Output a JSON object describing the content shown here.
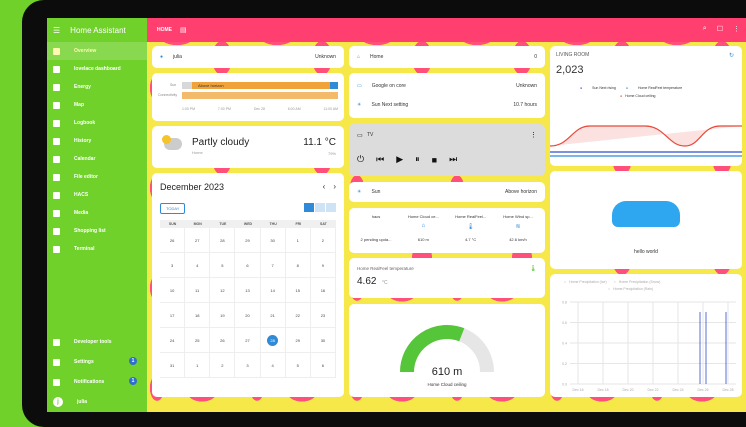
{
  "sidebar": {
    "title": "Home Assistant",
    "items": [
      {
        "label": "Overview",
        "active": true
      },
      {
        "label": "lovelace dashboard"
      },
      {
        "label": "Energy"
      },
      {
        "label": "Map"
      },
      {
        "label": "Logbook"
      },
      {
        "label": "History"
      },
      {
        "label": "Calendar"
      },
      {
        "label": "File editor"
      },
      {
        "label": "HACS"
      },
      {
        "label": "Media"
      },
      {
        "label": "Shopping list"
      },
      {
        "label": "Terminal"
      }
    ],
    "bottom": [
      {
        "label": "Developer tools"
      },
      {
        "label": "Settings",
        "badge": "1"
      },
      {
        "label": "Notifications",
        "badge": "1"
      },
      {
        "label": "julia",
        "avatar": "j"
      }
    ]
  },
  "topbar": {
    "title": "HOME"
  },
  "person": {
    "name": "julia",
    "state": "Unknown"
  },
  "history": {
    "labels": [
      "Sun",
      "Connectivity"
    ],
    "bar_label": "Above horizon",
    "ticks": [
      "1:00 PM",
      "7:00 PM",
      "Dec 28",
      "6:00 AM",
      "11:00 AM"
    ]
  },
  "weather": {
    "condition": "Partly cloudy",
    "sub": "Home",
    "temp": "11.1 °C",
    "hum": "79%"
  },
  "calendar": {
    "title": "December 2023",
    "today_btn": "TODAY",
    "days": [
      "SUN",
      "MON",
      "TUE",
      "WED",
      "THU",
      "FRI",
      "SAT"
    ],
    "cells": [
      "26",
      "27",
      "28",
      "29",
      "30",
      "1",
      "2",
      "3",
      "4",
      "5",
      "6",
      "7",
      "8",
      "9",
      "10",
      "11",
      "12",
      "13",
      "14",
      "15",
      "16",
      "17",
      "18",
      "19",
      "20",
      "21",
      "22",
      "23",
      "24",
      "25",
      "26",
      "27",
      "28",
      "29",
      "30",
      "31",
      "1",
      "2",
      "3",
      "4",
      "5",
      "6"
    ],
    "today_index": 32
  },
  "home_row": {
    "label": "Home",
    "value": "0"
  },
  "entities": [
    {
      "label": "Google on core",
      "value": "Unknown"
    },
    {
      "label": "Sun Next setting",
      "value": "10.7 hours"
    }
  ],
  "media": {
    "title": "TV"
  },
  "sun": {
    "label": "Sun",
    "value": "Above horizon"
  },
  "glance": [
    {
      "title": "hacs",
      "value": "2 pending upda..."
    },
    {
      "title": "Home Cloud ce...",
      "value": "610 m"
    },
    {
      "title": "Home RealFeel...",
      "value": "4.7 °C"
    },
    {
      "title": "Home Wind sp...",
      "value": "42.6 km/h"
    }
  ],
  "sensor": {
    "title": "Home RealFeel temperature",
    "value": "4.62",
    "unit": "°C"
  },
  "gauge": {
    "value": "610 m",
    "label": "Home Cloud ceiling",
    "fraction": 0.62
  },
  "living": {
    "title": "LIVING ROOM",
    "value": "2,023",
    "legend": [
      "Sun Next rising",
      "Home RealFeel temperature",
      "Home Cloud ceiling"
    ]
  },
  "picture": {
    "label": "hello world"
  },
  "precip": {
    "legend": [
      "Home Precipitation (Ice)",
      "Home Precipitation (Snow)",
      "Home Precipitation (Rain)"
    ],
    "yticks": [
      "0.8",
      "0.6",
      "0.4",
      "0.2",
      "0.0"
    ],
    "xticks": [
      "Dec 16",
      "Dec 18",
      "Dec 20",
      "Dec 22",
      "Dec 24",
      "Dec 26",
      "Dec 28"
    ]
  },
  "colors": {
    "sidebar": "#6fd12a",
    "topbar": "#ff3f6f",
    "accent": "#2f8ad8",
    "gauge": "#55c53a"
  }
}
